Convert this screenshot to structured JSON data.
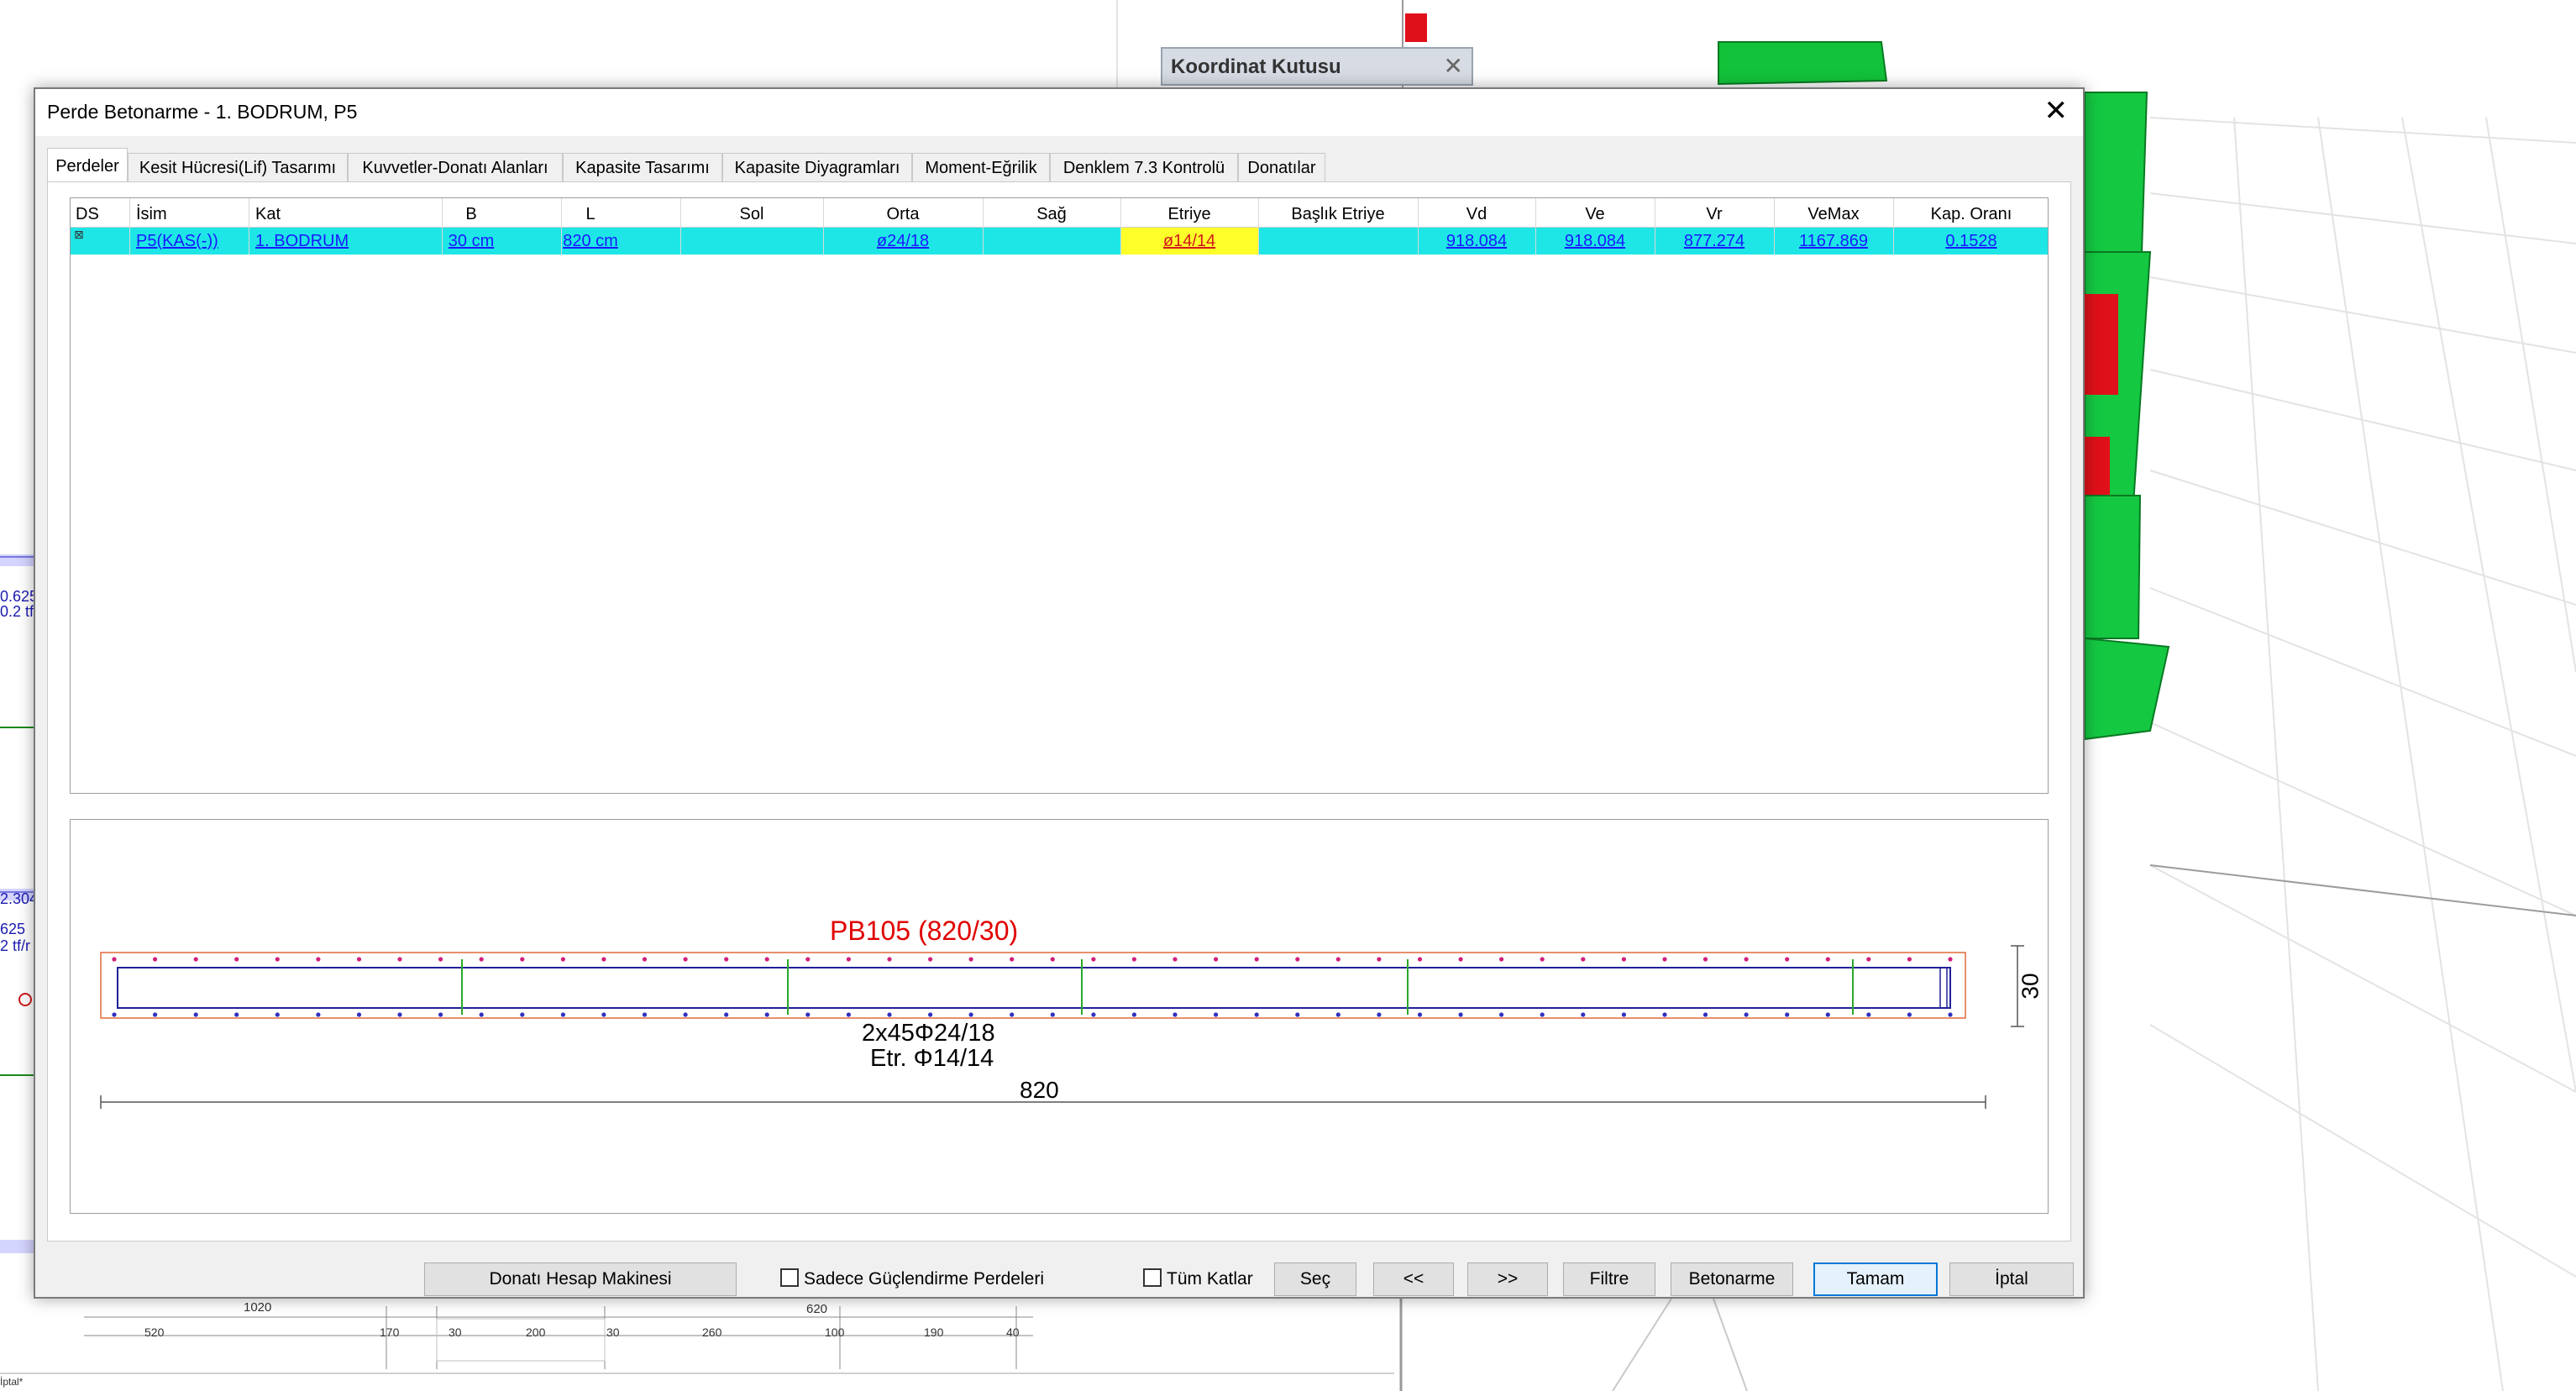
{
  "coord_box": {
    "title": "Koordinat Kutusu",
    "close": "✕"
  },
  "dialog": {
    "title": "Perde Betonarme - 1. BODRUM, P5",
    "close": "✕",
    "tabs": [
      {
        "label": "Perdeler",
        "active": true
      },
      {
        "label": "Kesit Hücresi(Lif) Tasarımı"
      },
      {
        "label": "Kuvvetler-Donatı Alanları"
      },
      {
        "label": "Kapasite Tasarımı"
      },
      {
        "label": "Kapasite Diyagramları"
      },
      {
        "label": "Moment-Eğrilik"
      },
      {
        "label": "Denklem 7.3 Kontrolü"
      },
      {
        "label": "Donatılar"
      }
    ]
  },
  "table": {
    "headers": [
      "DS",
      "İsim",
      "Kat",
      "B",
      "L",
      "Sol",
      "Orta",
      "Sağ",
      "Etriye",
      "Başlık Etriye",
      "Vd",
      "Ve",
      "Vr",
      "VeMax",
      "Kap. Oranı"
    ],
    "rows": [
      {
        "ds": "⊠",
        "isim": "P5(KAS(-))",
        "kat": "1. BODRUM",
        "b": "30 cm",
        "l": "820 cm",
        "sol": "",
        "orta": "ø24/18",
        "sag": "",
        "etriye": "ø14/14",
        "baslik_etriye": "",
        "vd": "918.084",
        "ve": "918.084",
        "vr": "877.274",
        "vemax": "1167.869",
        "kap_orani": "0.1528"
      }
    ],
    "row_color": "#1ee6e6",
    "highlight_color": "#ffff2a"
  },
  "drawing": {
    "title": "PB105 (820/30)",
    "rebar_text": "2x45Φ24/18",
    "stirrup_text": "Etr. Φ14/14",
    "length_dim": "820",
    "width_dim": "30",
    "title_color": "#e00000"
  },
  "buttons": {
    "calculator": "Donatı Hesap Makinesi",
    "only_strengthening": "Sadece Güçlendirme Perdeleri",
    "all_floors": "Tüm Katlar",
    "select": "Seç",
    "prev": "<<",
    "next": ">>",
    "filter": "Filtre",
    "concrete": "Betonarme",
    "ok": "Tamam",
    "cancel": "İptal"
  },
  "background": {
    "side_labels_left": [
      "0.625",
      "0.2 tf",
      "2.304",
      "625",
      "2 tf/r"
    ],
    "bottom_dims_top": [
      "1020",
      "620"
    ],
    "bottom_dims": [
      "520",
      "170",
      "30",
      "200",
      "30",
      "260",
      "100",
      "190",
      "40"
    ],
    "status_text": "İptal*"
  }
}
